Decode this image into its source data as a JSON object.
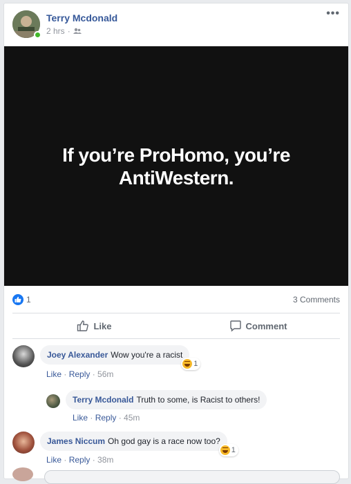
{
  "post": {
    "author": "Terry Mcdonald",
    "time": "2 hrs",
    "audience_icon": "friends-icon",
    "more_label": "•••",
    "image_text": "If you’re ProHomo, you’re AntiWestern."
  },
  "stats": {
    "like_count": "1",
    "comments_label": "3 Comments"
  },
  "actions": {
    "like_label": "Like",
    "comment_label": "Comment"
  },
  "comments": [
    {
      "name": "Joey Alexander",
      "text": "Wow you're a racist",
      "like": "Like",
      "reply": "Reply",
      "time": "56m",
      "reaction_count": "1"
    },
    {
      "name": "Terry Mcdonald",
      "text": "Truth to some, is Racist to others!",
      "like": "Like",
      "reply": "Reply",
      "time": "45m"
    },
    {
      "name": "James Niccum",
      "text": "Oh god gay is a race now too?",
      "like": "Like",
      "reply": "Reply",
      "time": "38m",
      "reaction_count": "1"
    }
  ],
  "colors": {
    "link_blue": "#385898",
    "like_blue": "#1877f2",
    "online_green": "#42b72a"
  }
}
